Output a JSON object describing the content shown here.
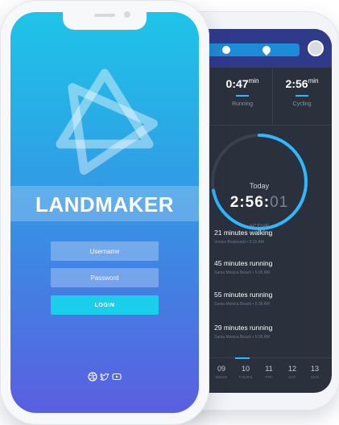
{
  "colors": {
    "front_gradient_top": "#1fc4e9",
    "front_gradient_bottom": "#5a5fe0",
    "login_button": "#19cfe9",
    "back_screen_bg": "#2a313c",
    "back_header": "#2f3a8a",
    "accent_blue": "#2fb7ff"
  },
  "login_screen": {
    "logo_icon": "star-knot-logo-icon",
    "brand_name": "LANDMAKER",
    "username_placeholder": "Username",
    "password_placeholder": "Password",
    "login_label": "LOGIN",
    "social_icons": [
      "dribbble-icon",
      "twitter-icon",
      "youtube-icon"
    ]
  },
  "activity_screen": {
    "header_icons": [
      "clock-icon",
      "drop-icon"
    ],
    "avatar": "avatar-icon",
    "stats": [
      {
        "value": "0:47",
        "unit": "min",
        "label": "Running"
      },
      {
        "value": "2:56",
        "unit": "min",
        "label": "Cycling"
      }
    ],
    "today": {
      "label": "Today",
      "time_main": "2:56:",
      "time_dim": "01",
      "status": "ACTIVE",
      "progress_fraction": 0.72
    },
    "activities": [
      {
        "title": "21 minutes walking",
        "subtitle": "Venice Boulevard • 5:15 AM"
      },
      {
        "title": "45 minutes running",
        "subtitle": "Santa Monica Beach • 5:36 AM"
      },
      {
        "title": "55 minutes running",
        "subtitle": "Santa Monica Beach • 5:36 AM"
      },
      {
        "title": "29 minutes running",
        "subtitle": "Santa Monica Beach • 5:36 AM"
      }
    ],
    "week": [
      {
        "num": "09",
        "name": "WEDS"
      },
      {
        "num": "10",
        "name": "THURS",
        "selected": true
      },
      {
        "num": "11",
        "name": "FRI"
      },
      {
        "num": "12",
        "name": "SAT"
      },
      {
        "num": "13",
        "name": "SUN"
      }
    ]
  }
}
